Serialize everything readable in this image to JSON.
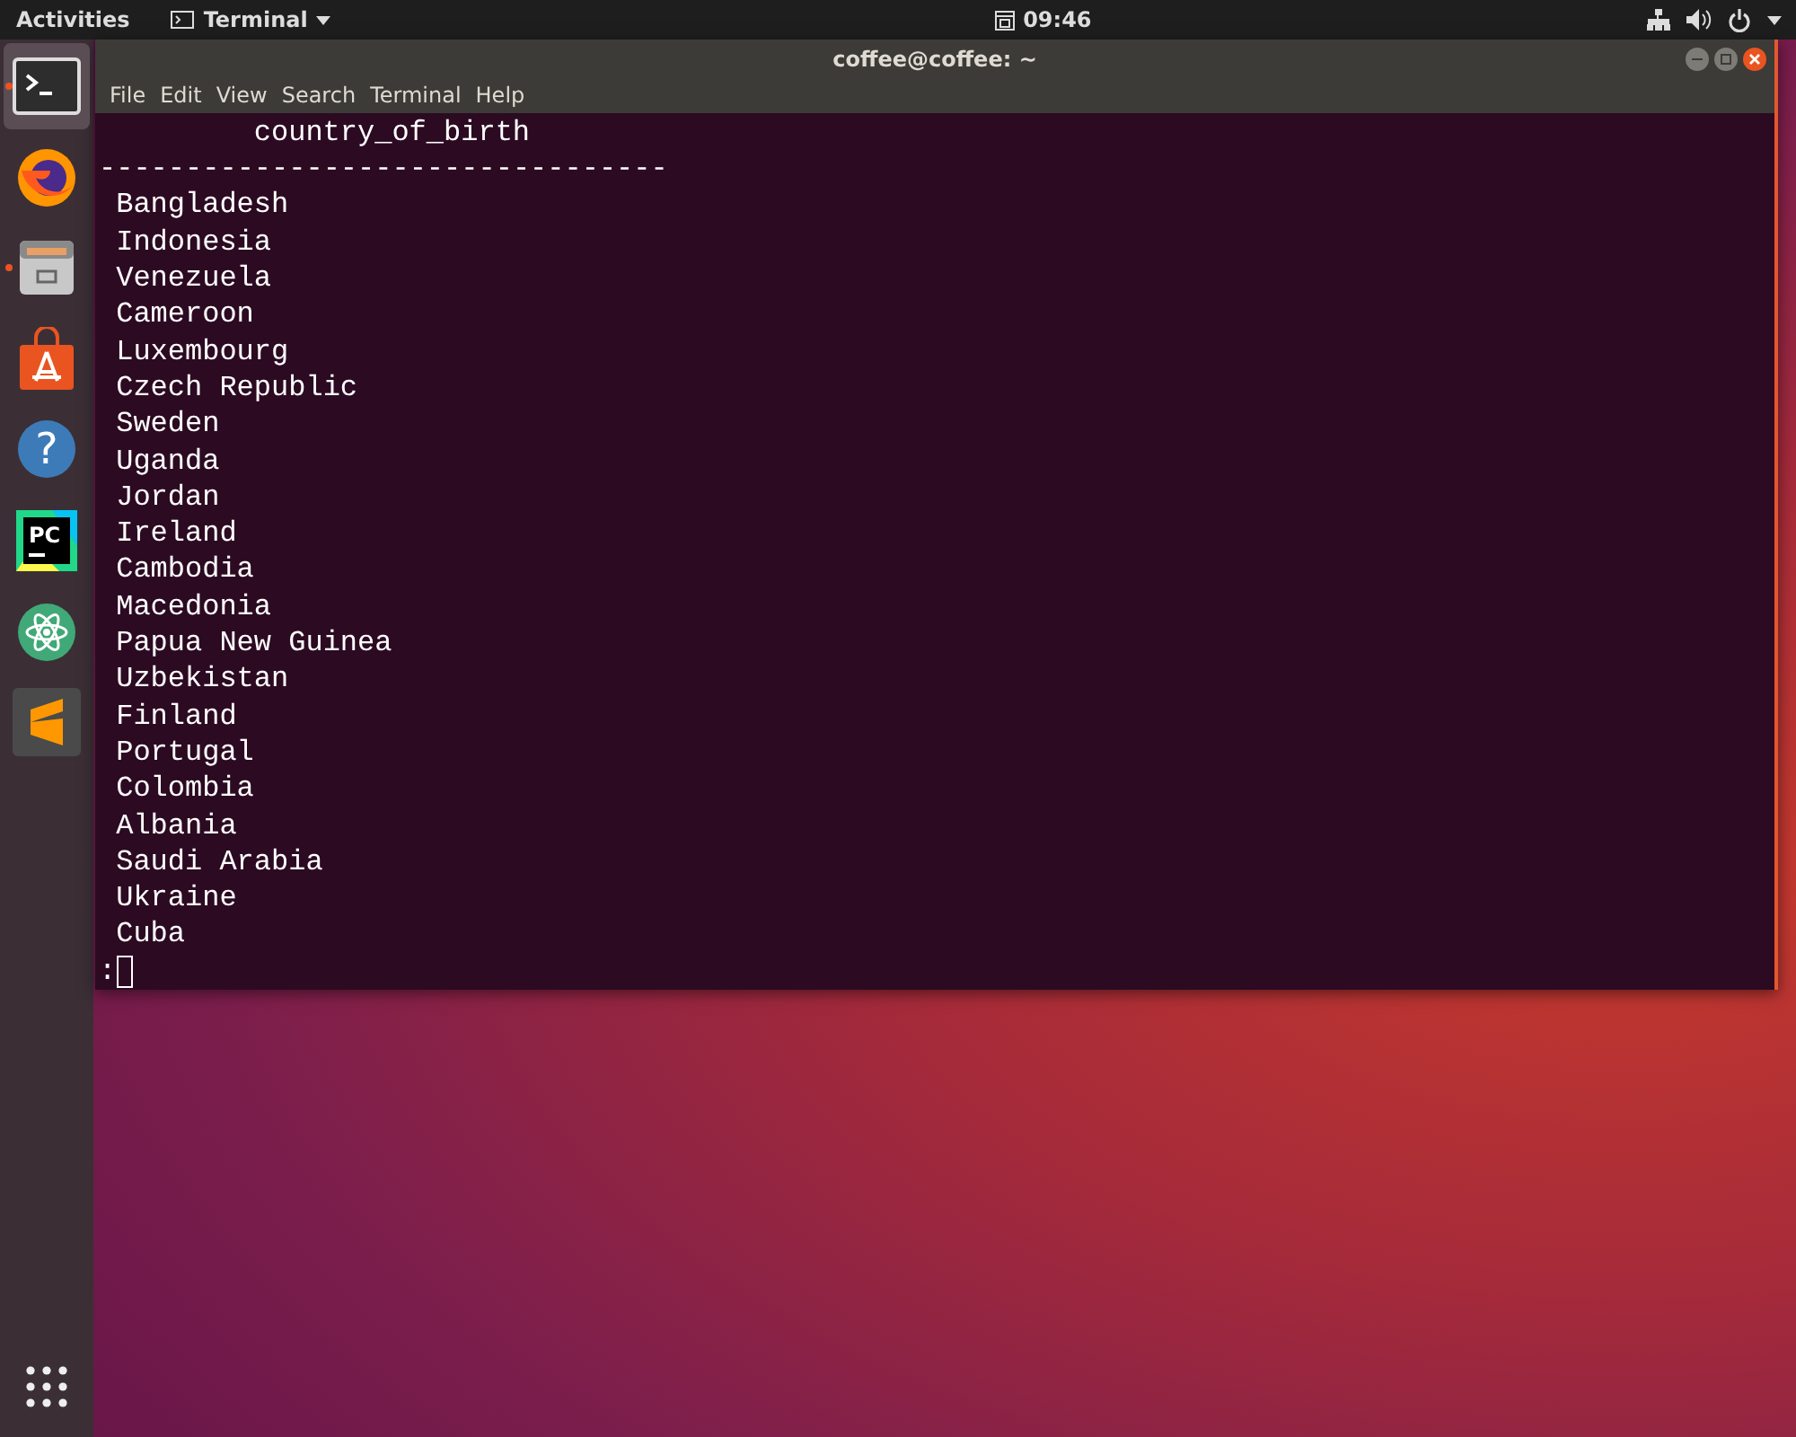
{
  "top_bar": {
    "activities": "Activities",
    "app_menu": "Terminal",
    "clock": "09:46"
  },
  "dock": [
    {
      "kind": "terminal",
      "selected": true,
      "running": true
    },
    {
      "kind": "firefox",
      "selected": false,
      "running": false
    },
    {
      "kind": "files",
      "selected": false,
      "running": true
    },
    {
      "kind": "software",
      "selected": false,
      "running": false
    },
    {
      "kind": "help",
      "selected": false,
      "running": false,
      "glyph": "?"
    },
    {
      "kind": "pycharm",
      "selected": false,
      "running": false,
      "glyph": "PC"
    },
    {
      "kind": "atom",
      "selected": false,
      "running": false
    },
    {
      "kind": "sublime",
      "selected": false,
      "running": false
    }
  ],
  "window": {
    "title": "coffee@coffee: ~",
    "menu": [
      "File",
      "Edit",
      "View",
      "Search",
      "Terminal",
      "Help"
    ]
  },
  "terminal": {
    "header": "country_of_birth",
    "separator": "---------------------------------",
    "rows": [
      "Bangladesh",
      "Indonesia",
      "Venezuela",
      "Cameroon",
      "Luxembourg",
      "Czech Republic",
      "Sweden",
      "Uganda",
      "Jordan",
      "Ireland",
      "Cambodia",
      "Macedonia",
      "Papua New Guinea",
      "Uzbekistan",
      "Finland",
      "Portugal",
      "Colombia",
      "Albania",
      "Saudi Arabia",
      "Ukraine",
      "Cuba"
    ],
    "prompt": ":"
  }
}
